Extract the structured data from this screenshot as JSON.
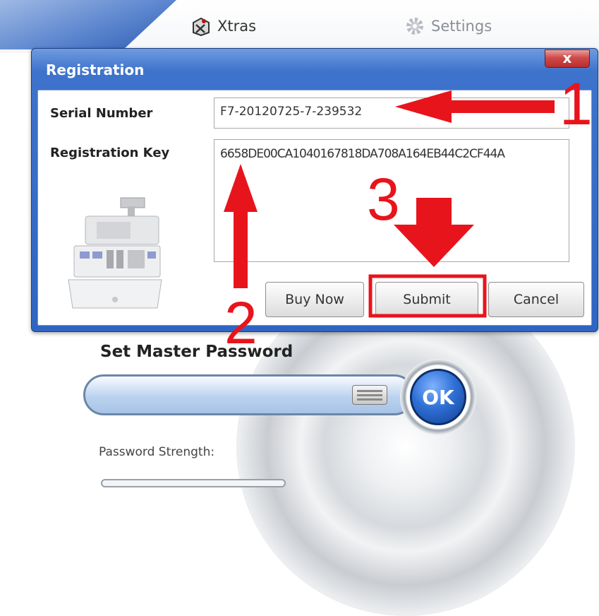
{
  "background_app": {
    "nav": [
      {
        "label": "Xtras",
        "icon": "xtras-icon"
      },
      {
        "label": "Settings",
        "icon": "gear-icon"
      }
    ],
    "master_password_title": "Set Master Password",
    "ok_label": "OK",
    "strength_label": "Password Strength:",
    "keyboard_icon": "keyboard-icon"
  },
  "dialog": {
    "title": "Registration",
    "close_label": "x",
    "serial_label": "Serial Number",
    "serial_value": "F7-20120725-7-239532",
    "key_label": "Registration Key",
    "key_value": "6658DE00CA1040167818DA708A164EB44C2CF44A",
    "illustration": "cash-register-icon",
    "buttons": {
      "buy_now": "Buy Now",
      "submit": "Submit",
      "cancel": "Cancel"
    }
  },
  "annotations": {
    "step1": "1",
    "step2": "2",
    "step3": "3",
    "color": "#e8141c"
  },
  "colors": {
    "title_bar": "#2f65c2",
    "close_button": "#cf4a4a",
    "ok_button": "#2f70d6"
  }
}
